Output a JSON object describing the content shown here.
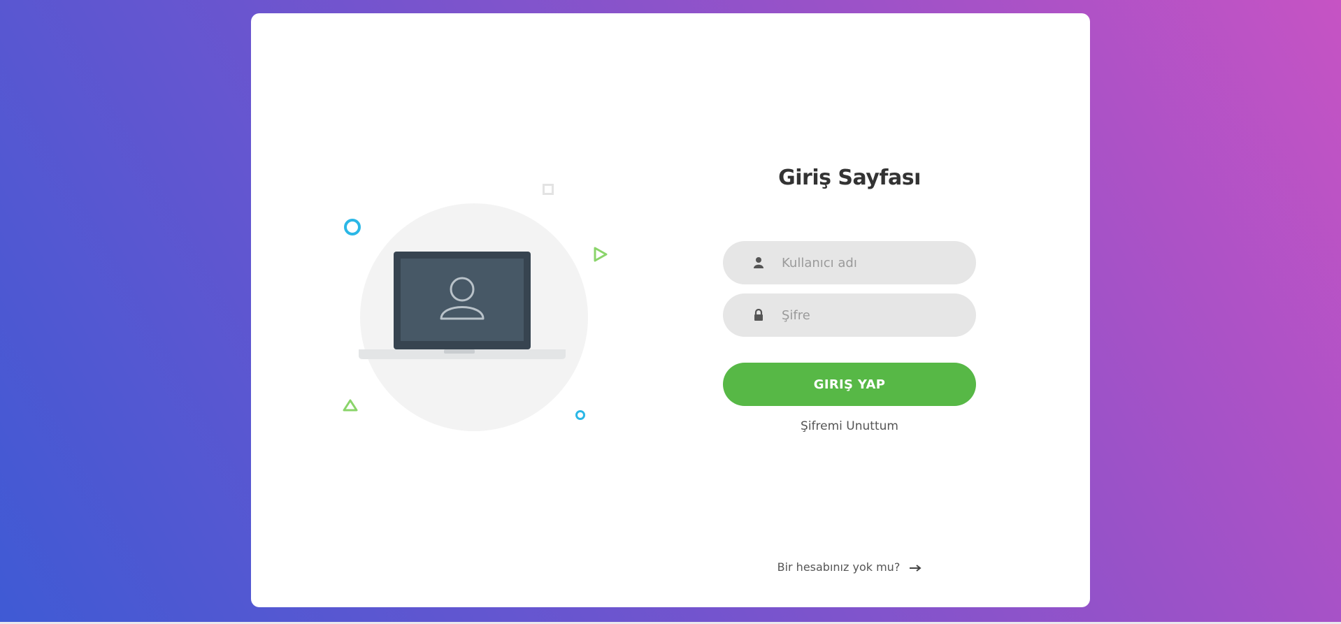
{
  "login": {
    "title": "Giriş Sayfası",
    "username_placeholder": "Kullanıcı adı",
    "username_value": "",
    "username_icon": "user-icon",
    "password_placeholder": "Şifre",
    "password_value": "",
    "password_icon": "lock-icon",
    "submit_label": "GIRIŞ YAP",
    "forgot_label": "Şifremi Unuttum",
    "signup_label": "Bir hesabınız yok mu?",
    "signup_icon": "arrow-right-icon"
  },
  "colors": {
    "background_gradient": [
      "#3f5ad4",
      "#c653c4"
    ],
    "card": "#ffffff",
    "accent_green": "#57b846",
    "field_bg": "#e6e6e6",
    "deco_blue": "#2bb7e6",
    "deco_green": "#8ad46a"
  }
}
